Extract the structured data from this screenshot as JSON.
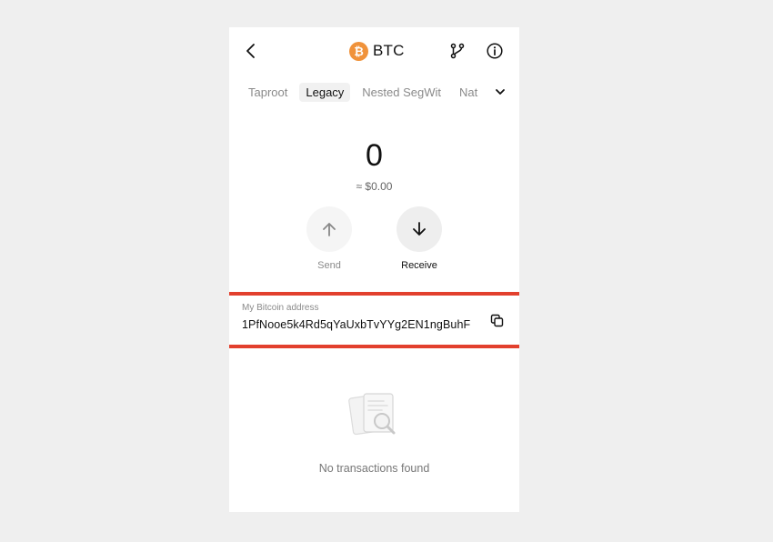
{
  "header": {
    "title": "BTC",
    "coin_symbol": "₿",
    "icons": [
      "back-arrow-icon",
      "branch-icon",
      "info-icon"
    ]
  },
  "tabs": [
    {
      "label": "Taproot",
      "active": false
    },
    {
      "label": "Legacy",
      "active": true
    },
    {
      "label": "Nested SegWit",
      "active": false
    },
    {
      "label": "Nat",
      "active": false
    }
  ],
  "balance": {
    "amount": "0",
    "fiat": "≈ $0.00"
  },
  "actions": {
    "send_label": "Send",
    "receive_label": "Receive"
  },
  "address": {
    "label": "My Bitcoin address",
    "value": "1PfNooe5k4Rd5qYaUxbTvYYg2EN1ngBuhF"
  },
  "transactions": {
    "empty_text": "No transactions found"
  },
  "colors": {
    "accent_btc": "#f0923a",
    "highlight_border": "#e2402d",
    "page_bg": "#efefef"
  }
}
